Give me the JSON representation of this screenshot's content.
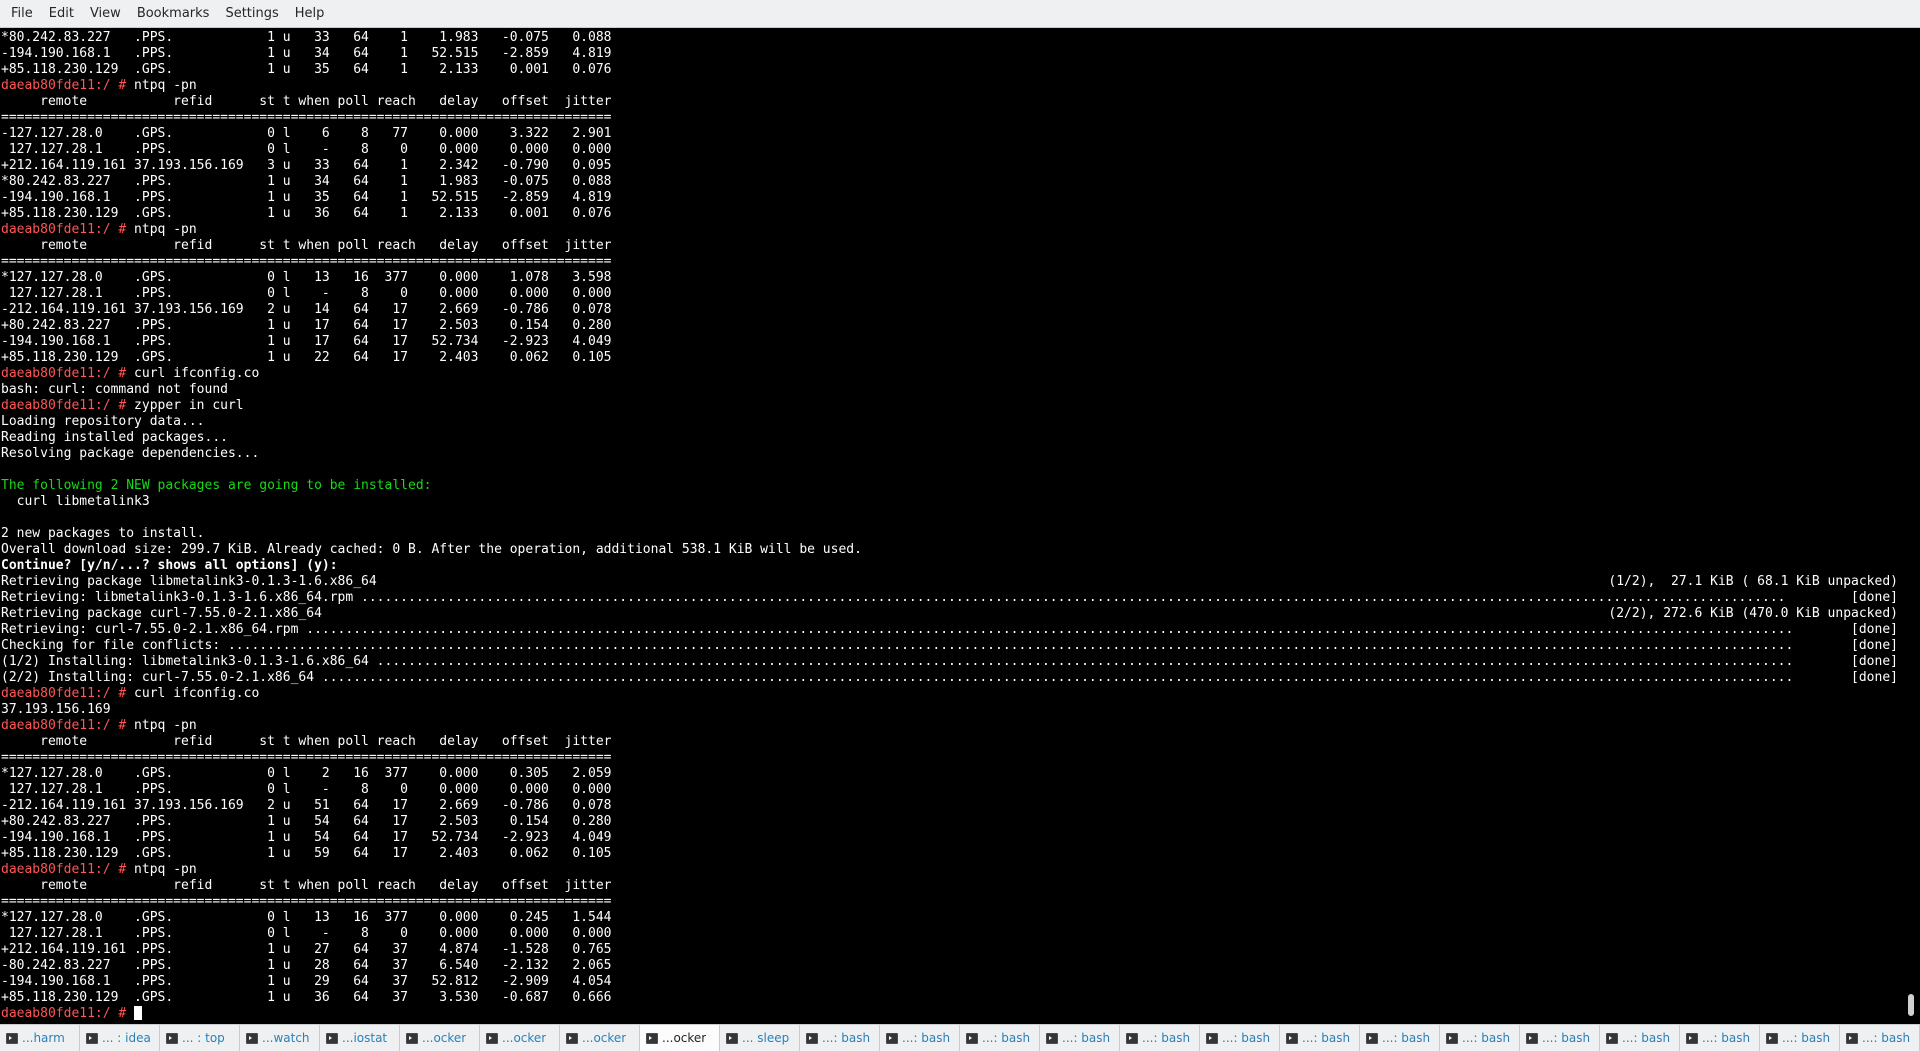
{
  "menubar": {
    "items": [
      "File",
      "Edit",
      "View",
      "Bookmarks",
      "Settings",
      "Help"
    ]
  },
  "terminal": {
    "prompt": "daeab80fde11:/ #",
    "lines": [
      {
        "t": "*80.242.83.227   .PPS.            1 u   33   64    1    1.983   -0.075   0.088"
      },
      {
        "t": "-194.190.168.1   .PPS.            1 u   34   64    1   52.515   -2.859   4.819"
      },
      {
        "t": "+85.118.230.129  .GPS.            1 u   35   64    1    2.133    0.001   0.076"
      },
      {
        "p": true,
        "t": " ntpq -pn"
      },
      {
        "t": "     remote           refid      st t when poll reach   delay   offset  jitter"
      },
      {
        "t": "=============================================================================="
      },
      {
        "t": "-127.127.28.0    .GPS.            0 l    6    8   77    0.000    3.322   2.901"
      },
      {
        "t": " 127.127.28.1    .PPS.            0 l    -    8    0    0.000    0.000   0.000"
      },
      {
        "t": "+212.164.119.161 37.193.156.169   3 u   33   64    1    2.342   -0.790   0.095"
      },
      {
        "t": "*80.242.83.227   .PPS.            1 u   34   64    1    1.983   -0.075   0.088"
      },
      {
        "t": "-194.190.168.1   .PPS.            1 u   35   64    1   52.515   -2.859   4.819"
      },
      {
        "t": "+85.118.230.129  .GPS.            1 u   36   64    1    2.133    0.001   0.076"
      },
      {
        "p": true,
        "t": " ntpq -pn"
      },
      {
        "t": "     remote           refid      st t when poll reach   delay   offset  jitter"
      },
      {
        "t": "=============================================================================="
      },
      {
        "t": "*127.127.28.0    .GPS.            0 l   13   16  377    0.000    1.078   3.598"
      },
      {
        "t": " 127.127.28.1    .PPS.            0 l    -    8    0    0.000    0.000   0.000"
      },
      {
        "t": "-212.164.119.161 37.193.156.169   2 u   14   64   17    2.669   -0.786   0.078"
      },
      {
        "t": "+80.242.83.227   .PPS.            1 u   17   64   17    2.503    0.154   0.280"
      },
      {
        "t": "-194.190.168.1   .PPS.            1 u   17   64   17   52.734   -2.923   4.049"
      },
      {
        "t": "+85.118.230.129  .GPS.            1 u   22   64   17    2.403    0.062   0.105"
      },
      {
        "p": true,
        "t": " curl ifconfig.co"
      },
      {
        "t": "bash: curl: command not found"
      },
      {
        "p": true,
        "t": " zypper in curl"
      },
      {
        "t": "Loading repository data..."
      },
      {
        "t": "Reading installed packages..."
      },
      {
        "t": "Resolving package dependencies..."
      },
      {
        "t": ""
      },
      {
        "g": true,
        "t": "The following 2 NEW packages are going to be installed:"
      },
      {
        "t": "  curl libmetalink3"
      },
      {
        "t": ""
      },
      {
        "t": "2 new packages to install."
      },
      {
        "t": "Overall download size: 299.7 KiB. Already cached: 0 B. After the operation, additional 538.1 KiB will be used."
      },
      {
        "b": true,
        "t": "Continue? [y/n/...? shows all options] (y):"
      },
      {
        "t": "Retrieving package libmetalink3-0.1.3-1.6.x86_64",
        "r": "(1/2),  27.1 KiB ( 68.1 KiB unpacked)"
      },
      {
        "t": "Retrieving: libmetalink3-0.1.3-1.6.x86_64.rpm ......................................................................................................................................................................................",
        "r": "[done]"
      },
      {
        "t": "Retrieving package curl-7.55.0-2.1.x86_64",
        "r": "(2/2), 272.6 KiB (470.0 KiB unpacked)"
      },
      {
        "t": "Retrieving: curl-7.55.0-2.1.x86_64.rpm ..............................................................................................................................................................................................",
        "r": "[done]"
      },
      {
        "t": "Checking for file conflicts: ........................................................................................................................................................................................................",
        "r": "[done]"
      },
      {
        "t": "(1/2) Installing: libmetalink3-0.1.3-1.6.x86_64 .....................................................................................................................................................................................",
        "r": "[done]"
      },
      {
        "t": "(2/2) Installing: curl-7.55.0-2.1.x86_64 ............................................................................................................................................................................................",
        "r": "[done]"
      },
      {
        "p": true,
        "t": " curl ifconfig.co"
      },
      {
        "t": "37.193.156.169"
      },
      {
        "p": true,
        "t": " ntpq -pn"
      },
      {
        "t": "     remote           refid      st t when poll reach   delay   offset  jitter"
      },
      {
        "t": "=============================================================================="
      },
      {
        "t": "*127.127.28.0    .GPS.            0 l    2   16  377    0.000    0.305   2.059"
      },
      {
        "t": " 127.127.28.1    .PPS.            0 l    -    8    0    0.000    0.000   0.000"
      },
      {
        "t": "-212.164.119.161 37.193.156.169   2 u   51   64   17    2.669   -0.786   0.078"
      },
      {
        "t": "+80.242.83.227   .PPS.            1 u   54   64   17    2.503    0.154   0.280"
      },
      {
        "t": "-194.190.168.1   .PPS.            1 u   54   64   17   52.734   -2.923   4.049"
      },
      {
        "t": "+85.118.230.129  .GPS.            1 u   59   64   17    2.403    0.062   0.105"
      },
      {
        "p": true,
        "t": " ntpq -pn"
      },
      {
        "t": "     remote           refid      st t when poll reach   delay   offset  jitter"
      },
      {
        "t": "=============================================================================="
      },
      {
        "t": "*127.127.28.0    .GPS.            0 l   13   16  377    0.000    0.245   1.544"
      },
      {
        "t": " 127.127.28.1    .PPS.            0 l    -    8    0    0.000    0.000   0.000"
      },
      {
        "t": "+212.164.119.161 .PPS.            1 u   27   64   37    4.874   -1.528   0.765"
      },
      {
        "t": "-80.242.83.227   .PPS.            1 u   28   64   37    6.540   -2.132   2.065"
      },
      {
        "t": "-194.190.168.1   .PPS.            1 u   29   64   37   52.812   -2.909   4.054"
      },
      {
        "t": "+85.118.230.129  .GPS.            1 u   36   64   37    3.530   -0.687   0.666"
      },
      {
        "p": true,
        "t": " ",
        "cursor": true
      }
    ]
  },
  "tabs": [
    {
      "label": "...harm",
      "active": false
    },
    {
      "label": "... : idea",
      "active": false
    },
    {
      "label": "... : top",
      "active": false
    },
    {
      "label": "...watch",
      "active": false
    },
    {
      "label": "...iostat",
      "active": false
    },
    {
      "label": "...ocker",
      "active": false
    },
    {
      "label": "...ocker",
      "active": false
    },
    {
      "label": "...ocker",
      "active": false
    },
    {
      "label": "...ocker",
      "active": true
    },
    {
      "label": "... sleep",
      "active": false
    },
    {
      "label": "...: bash",
      "active": false
    },
    {
      "label": "...: bash",
      "active": false
    },
    {
      "label": "...: bash",
      "active": false
    },
    {
      "label": "...: bash",
      "active": false
    },
    {
      "label": "...: bash",
      "active": false
    },
    {
      "label": "...: bash",
      "active": false
    },
    {
      "label": "...: bash",
      "active": false
    },
    {
      "label": "...: bash",
      "active": false
    },
    {
      "label": "...: bash",
      "active": false
    },
    {
      "label": "...: bash",
      "active": false
    },
    {
      "label": "...: bash",
      "active": false
    },
    {
      "label": "...: bash",
      "active": false
    },
    {
      "label": "...: bash",
      "active": false
    },
    {
      "label": "...: bash",
      "active": false
    }
  ]
}
